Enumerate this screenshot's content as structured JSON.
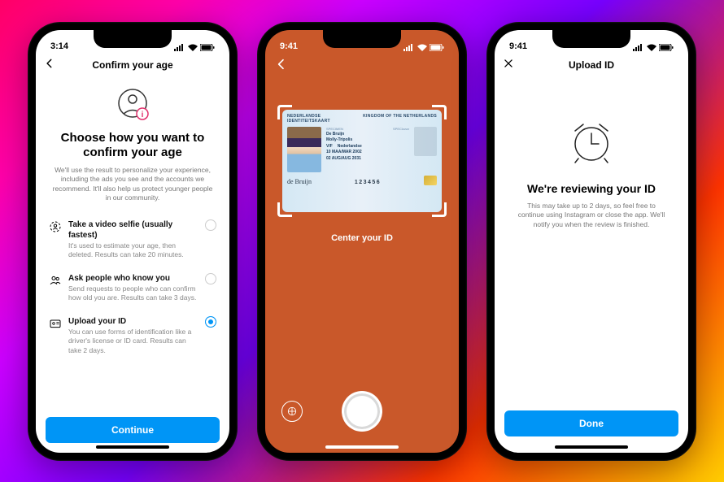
{
  "status": {
    "time1": "3:14",
    "time2": "9:41",
    "time3": "9:41"
  },
  "screen1": {
    "nav_title": "Confirm your age",
    "heading": "Choose how you want to confirm your age",
    "description": "We'll use the result to personalize your experience, including the ads you see and the accounts we recommend. It'll also help us protect younger people in our community.",
    "options": [
      {
        "title": "Take a video selfie (usually fastest)",
        "sub": "It's used to estimate your age, then deleted. Results can take 20 minutes."
      },
      {
        "title": "Ask people who know you",
        "sub": "Send requests to people who can confirm how old you are. Results can take 3 days."
      },
      {
        "title": "Upload your ID",
        "sub": "You can use forms of identification like a driver's license or ID card. Results can take 2 days."
      }
    ],
    "button": "Continue"
  },
  "screen2": {
    "instruction": "Center your ID",
    "id": {
      "country_l": "NEDERLANDSE",
      "doc_l": "IDENTITEITSKAART",
      "country_r": "KINGDOM OF THE NETHERLANDS",
      "spec": "SPECIMEN",
      "class": "SPECIzzzz",
      "surname": "De Bruijn",
      "given": "Molly-Tripolis",
      "gender": "V/F",
      "nationality": "Nederlandse",
      "dob": "10 MAA/MAR 2002",
      "expiry": "02 AUG/AUG 2031",
      "number": "123456"
    }
  },
  "screen3": {
    "nav_title": "Upload ID",
    "heading": "We're reviewing your ID",
    "description": "This may take up to 2 days, so feel free to continue using Instagram or close the app. We'll notify you when the review is finished.",
    "button": "Done"
  }
}
